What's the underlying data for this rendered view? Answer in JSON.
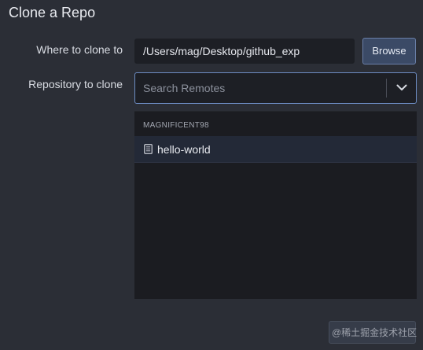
{
  "dialog": {
    "title": "Clone a Repo"
  },
  "form": {
    "where_label": "Where to clone to",
    "path_value": "/Users/mag/Desktop/github_exp",
    "browse_label": "Browse",
    "repo_label": "Repository to clone",
    "search_placeholder": "Search Remotes"
  },
  "remotes": {
    "groups": [
      {
        "name": "MAGNIFICENT98",
        "repos": [
          {
            "name": "hello-world",
            "icon": "repo-book-icon",
            "selected": true
          }
        ]
      }
    ]
  },
  "footer": {
    "watermark": "@稀土掘金技术社区",
    "icon": "clone-button"
  },
  "colors": {
    "background": "#2b2e36",
    "field_bg": "#1d1f25",
    "accent_border": "#6d8dc4",
    "browse_bg": "#3b4a66",
    "selected_row": "#232937"
  }
}
